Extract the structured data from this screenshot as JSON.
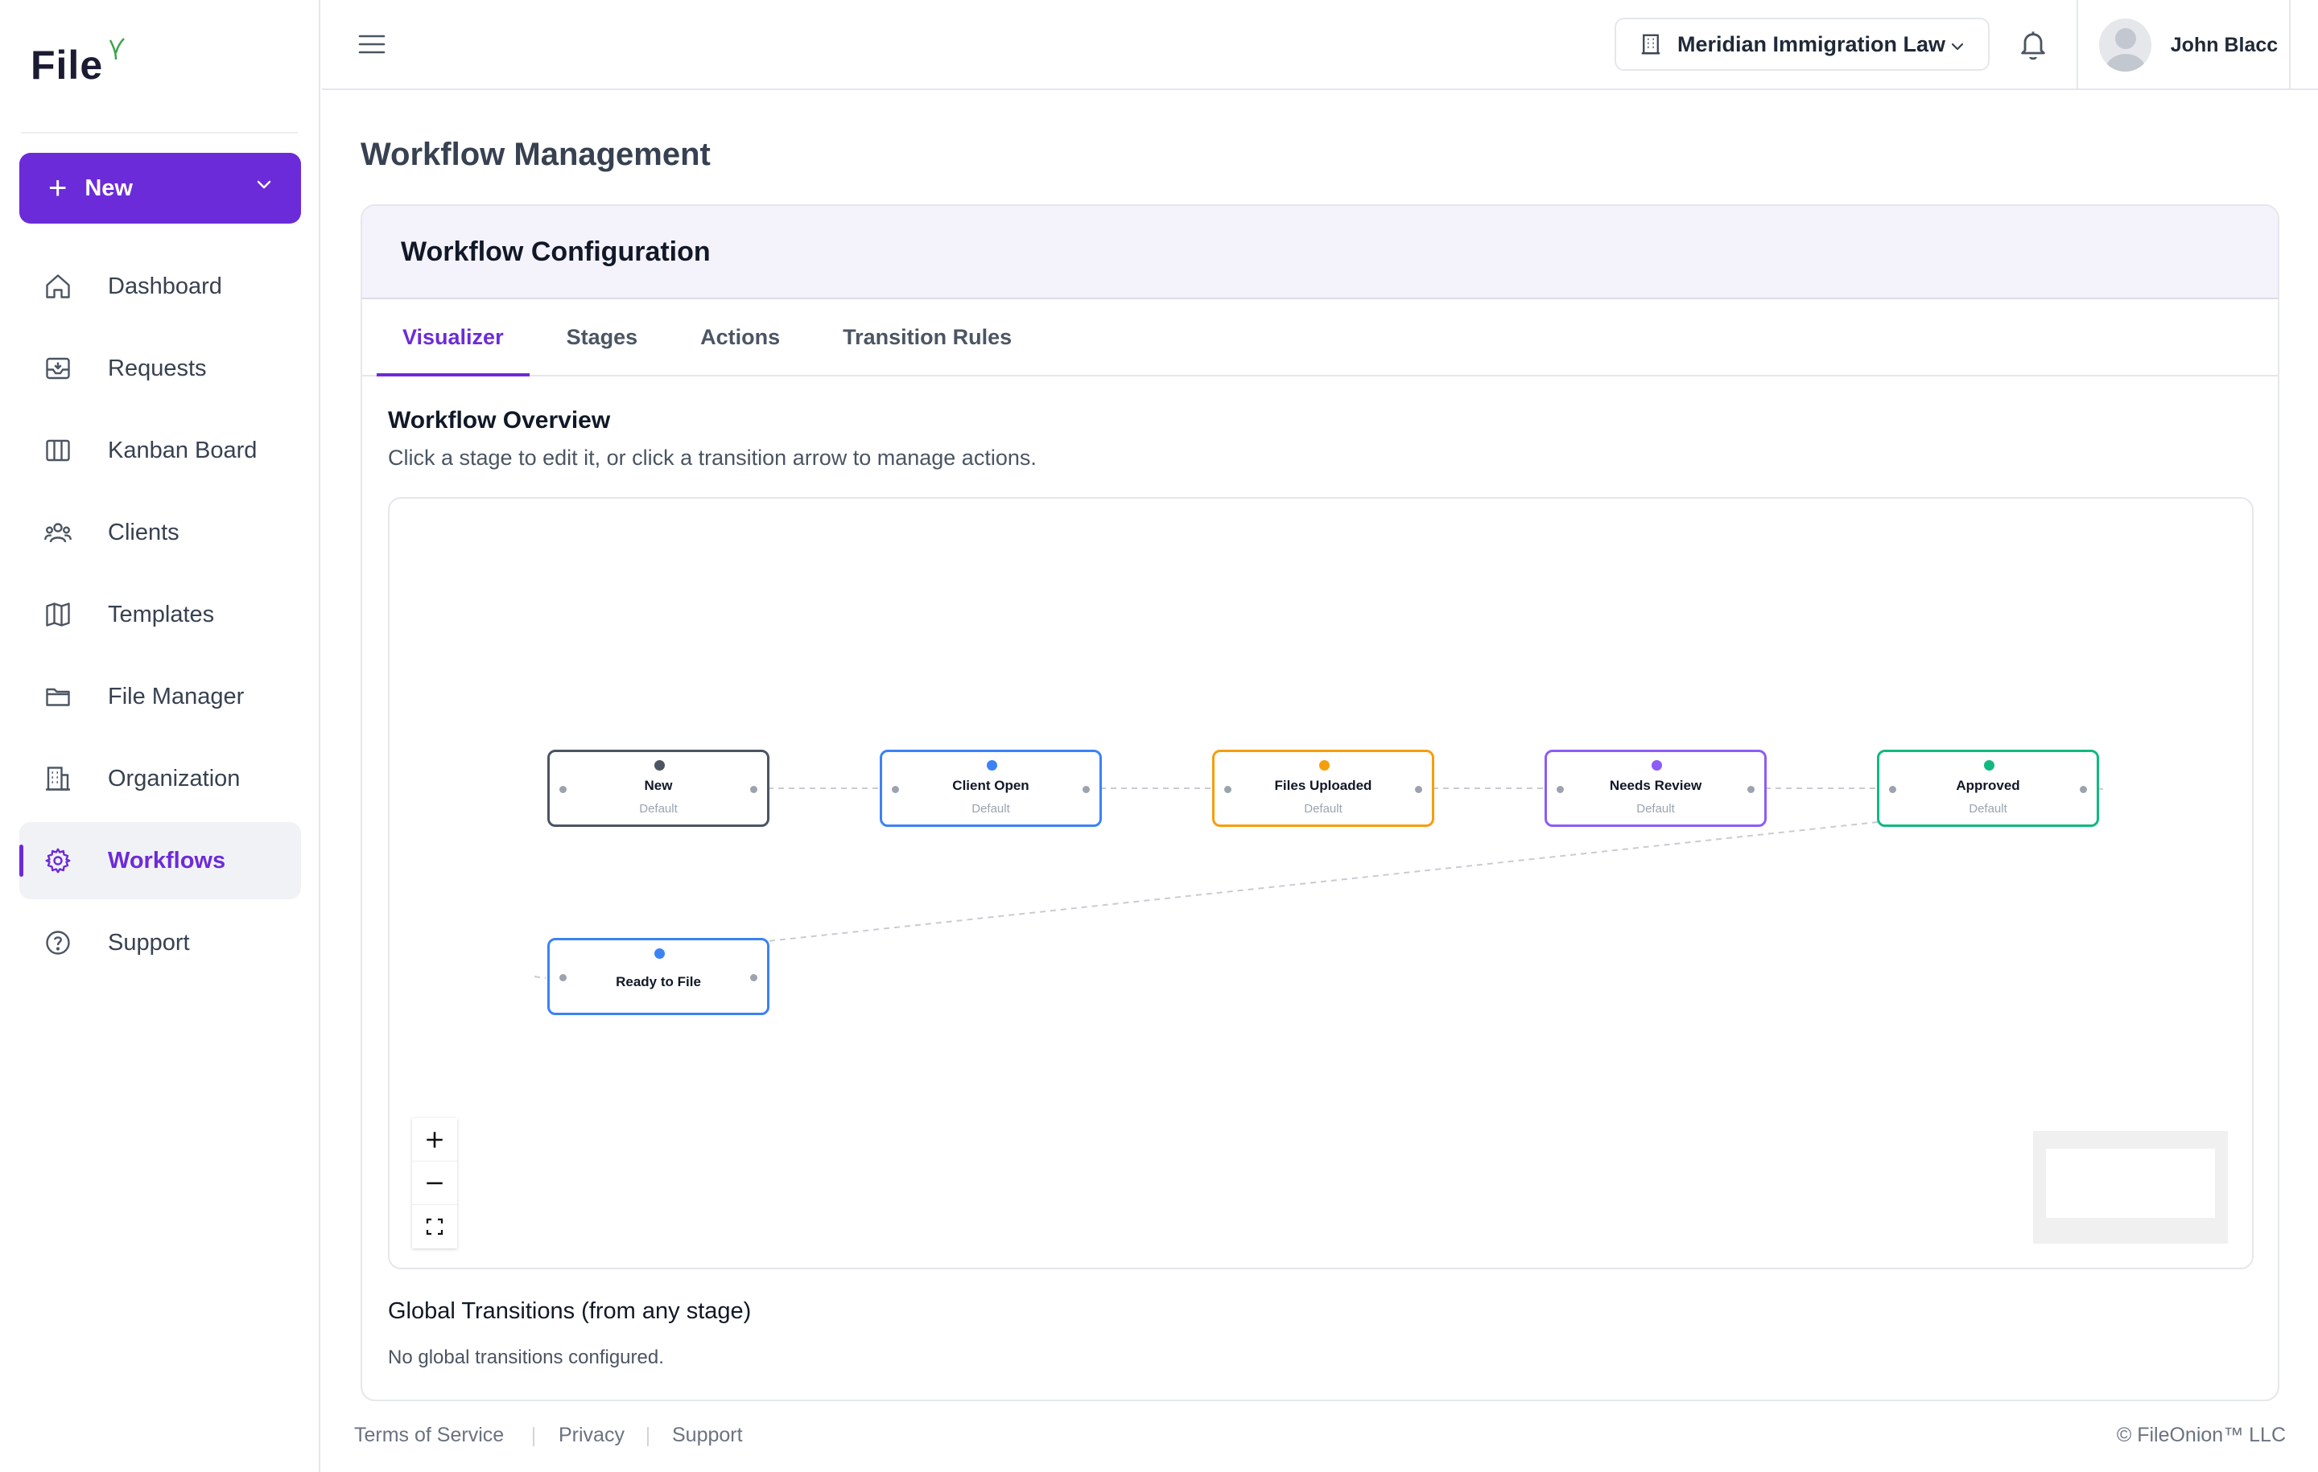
{
  "brand": {
    "logo_text": "File",
    "accent": "#6c2bd9"
  },
  "sidebar": {
    "new_button": "New",
    "items": [
      {
        "label": "Dashboard",
        "icon": "home-icon"
      },
      {
        "label": "Requests",
        "icon": "inbox-icon"
      },
      {
        "label": "Kanban Board",
        "icon": "columns-icon"
      },
      {
        "label": "Clients",
        "icon": "users-icon"
      },
      {
        "label": "Templates",
        "icon": "map-icon"
      },
      {
        "label": "File Manager",
        "icon": "folder-icon"
      },
      {
        "label": "Organization",
        "icon": "building-icon"
      },
      {
        "label": "Workflows",
        "icon": "gear-icon",
        "active": true
      },
      {
        "label": "Support",
        "icon": "help-circle-icon"
      }
    ]
  },
  "header": {
    "organization": "Meridian Immigration Law",
    "user_name": "John Blacc"
  },
  "main": {
    "page_title": "Workflow Management",
    "card_title": "Workflow Configuration",
    "tabs": [
      {
        "label": "Visualizer",
        "active": true
      },
      {
        "label": "Stages"
      },
      {
        "label": "Actions"
      },
      {
        "label": "Transition Rules"
      }
    ],
    "overview_title": "Workflow Overview",
    "overview_subtitle": "Click a stage to edit it, or click a transition arrow to manage actions.",
    "stages": [
      {
        "name": "New",
        "sub": "Default",
        "color": "#4b5563",
        "dot": "#4b5563"
      },
      {
        "name": "Client Open",
        "sub": "Default",
        "color": "#3b82f6",
        "dot": "#3b82f6"
      },
      {
        "name": "Files Uploaded",
        "sub": "Default",
        "color": "#f59e0b",
        "dot": "#f59e0b"
      },
      {
        "name": "Needs Review",
        "sub": "Default",
        "color": "#8b5cf6",
        "dot": "#8b5cf6"
      },
      {
        "name": "Approved",
        "sub": "Default",
        "color": "#10b981",
        "dot": "#10b981"
      },
      {
        "name": "Ready to File",
        "sub": "",
        "color": "#3b82f6",
        "dot": "#3b82f6"
      }
    ],
    "global_title": "Global Transitions (from any stage)",
    "global_empty": "No global transitions configured."
  },
  "footer": {
    "links": [
      "Terms of Service",
      "Privacy",
      "Support"
    ],
    "copyright": "© FileOnion™ LLC"
  }
}
